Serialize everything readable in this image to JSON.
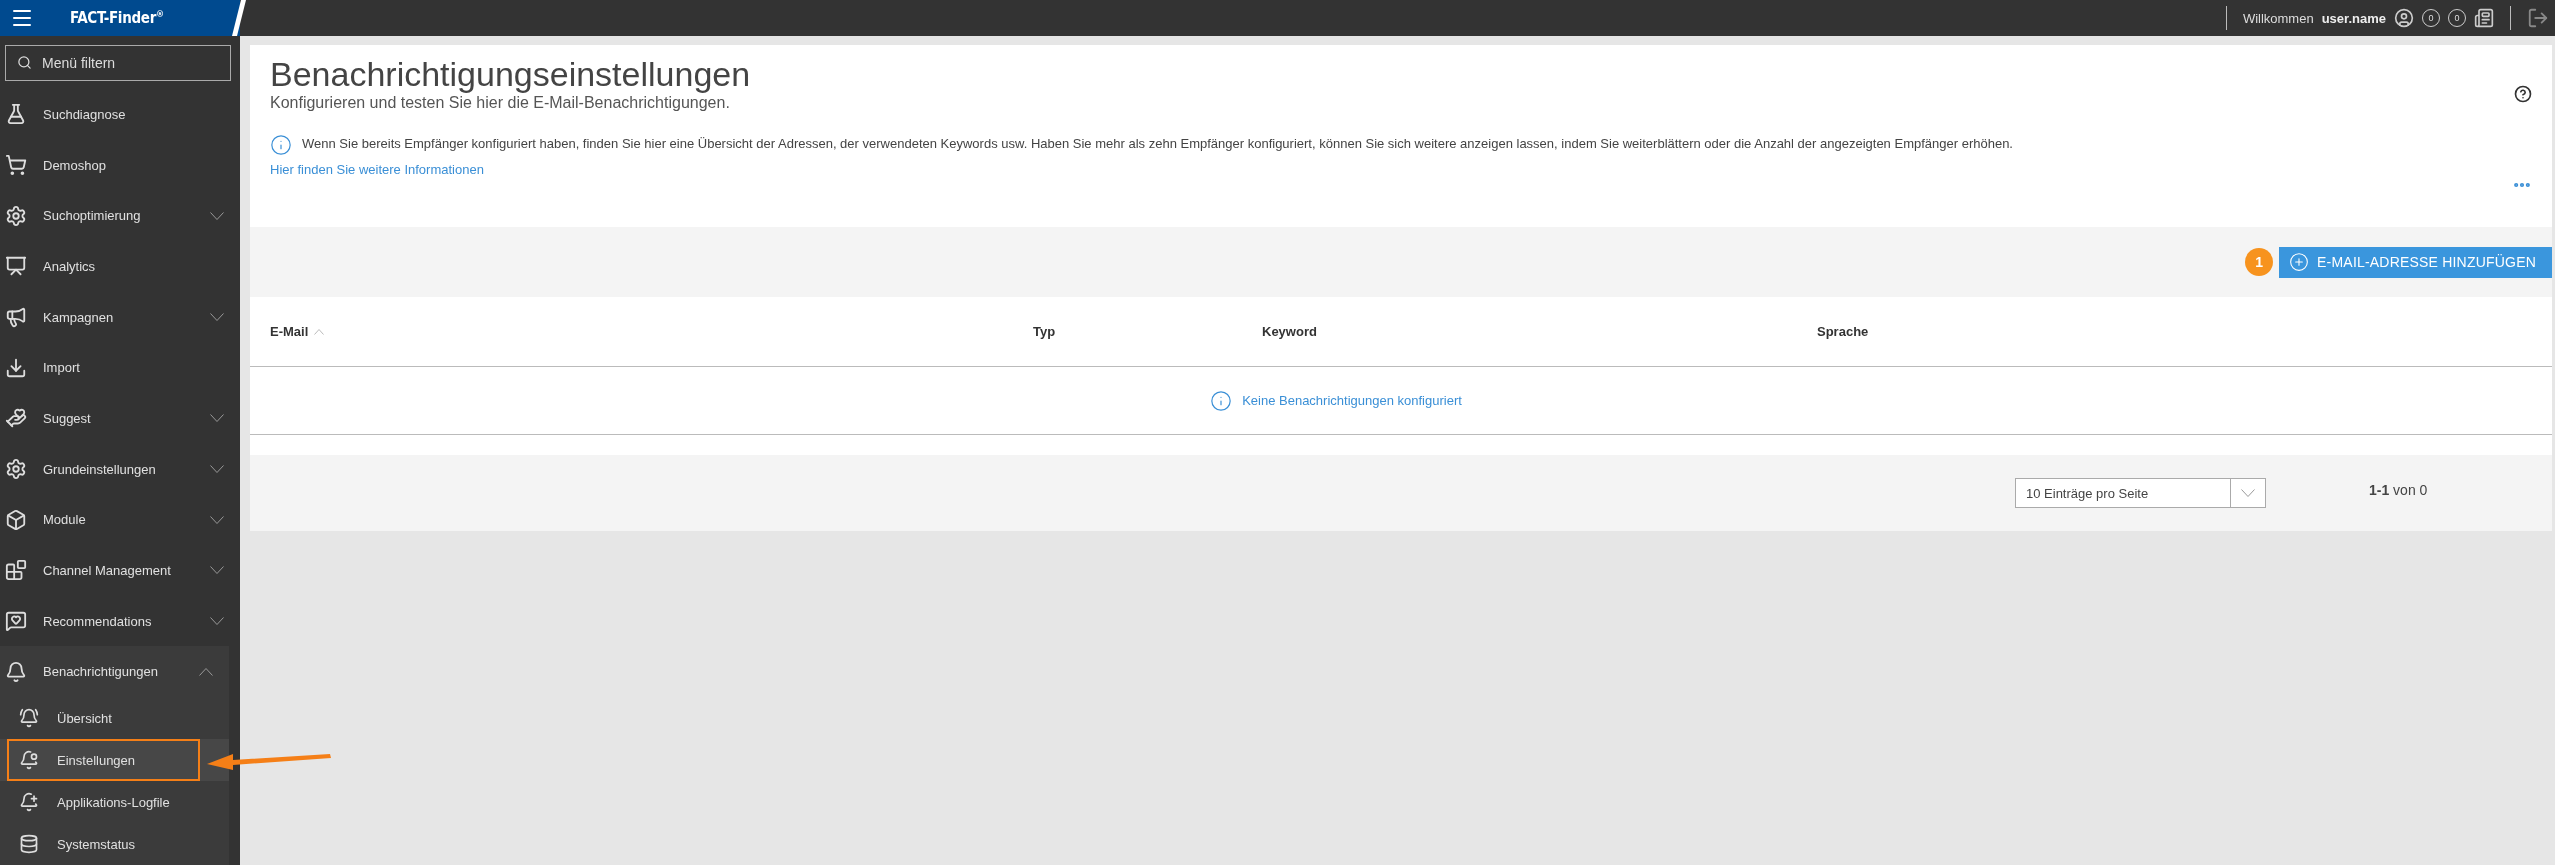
{
  "header": {
    "logo": "FACT-Finder",
    "logo_mark": "®",
    "welcome": "Willkommen",
    "user": "user.name",
    "counters": [
      "0",
      "0"
    ]
  },
  "sidebar": {
    "filter": {
      "placeholder": "Menü filtern"
    },
    "items": [
      {
        "label": "Suchdiagnose",
        "kind": "link",
        "expanded": false
      },
      {
        "label": "Demoshop",
        "kind": "link",
        "expanded": false
      },
      {
        "label": "Suchoptimierung",
        "kind": "group",
        "expanded": false
      },
      {
        "label": "Analytics",
        "kind": "link",
        "expanded": false
      },
      {
        "label": "Kampagnen",
        "kind": "group",
        "expanded": false
      },
      {
        "label": "Import",
        "kind": "link",
        "expanded": false
      },
      {
        "label": "Suggest",
        "kind": "group",
        "expanded": false
      },
      {
        "label": "Grundeinstellungen",
        "kind": "group",
        "expanded": false
      },
      {
        "label": "Module",
        "kind": "group",
        "expanded": false
      },
      {
        "label": "Channel Management",
        "kind": "group",
        "expanded": false
      },
      {
        "label": "Recommendations",
        "kind": "group",
        "expanded": false
      },
      {
        "label": "Benachrichtigungen",
        "kind": "group",
        "expanded": true,
        "children": [
          {
            "label": "Übersicht",
            "selected": false
          },
          {
            "label": "Einstellungen",
            "selected": true
          },
          {
            "label": "Applikations-Logfile",
            "selected": false
          },
          {
            "label": "Systemstatus",
            "selected": false
          }
        ]
      }
    ]
  },
  "page": {
    "title": "Benachrichtigungseinstellungen",
    "subtitle": "Konfigurieren und testen Sie hier die E-Mail-Benachrichtigungen.",
    "info": "Wenn Sie bereits Empfänger konfiguriert haben, finden Sie hier eine Übersicht der Adressen, der verwendeten Keywords usw. Haben Sie mehr als zehn Empfänger konfiguriert, können Sie sich weitere anzeigen lassen, indem Sie weiterblättern oder die Anzahl der angezeigten Empfänger erhöhen.",
    "info_link": "Hier finden Sie weitere Informationen",
    "add_button": "E-MAIL-ADRESSE HINZUFÜGEN",
    "badge": "1"
  },
  "table": {
    "columns": [
      {
        "label": "E-Mail",
        "sorted": true
      },
      {
        "label": "Typ",
        "sorted": false
      },
      {
        "label": "Keyword",
        "sorted": false
      },
      {
        "label": "Sprache",
        "sorted": false
      }
    ],
    "empty_message": "Keine Benachrichtigungen konfiguriert"
  },
  "pagination": {
    "per_page": "10 Einträge pro Seite",
    "range": "**1-1** von 0"
  },
  "annotation": {
    "kind": "arrow_frame"
  }
}
